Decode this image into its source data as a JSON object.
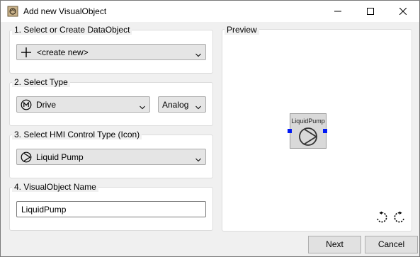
{
  "window": {
    "title": "Add new VisualObject",
    "icon": "app-cube-icon",
    "controls": [
      "minimize-icon",
      "maximize-icon",
      "close-icon"
    ]
  },
  "step1": {
    "label": "1. Select or Create DataObject",
    "value": "<create new>",
    "icon": "plus-icon"
  },
  "step2": {
    "label": "2. Select Type",
    "type_value": "Drive",
    "type_icon": "m-circle-icon",
    "signal_value": "Analog"
  },
  "step3": {
    "label": "3. Select HMI Control Type (Icon)",
    "value": "Liquid Pump",
    "icon": "pump-icon"
  },
  "step4": {
    "label": "4. VisualObject Name",
    "value": "LiquidPump"
  },
  "preview": {
    "label": "Preview",
    "object_label": "LiquidPump",
    "rotate_left_icon": "rotate-left-icon",
    "rotate_right_icon": "rotate-right-icon"
  },
  "buttons": {
    "next": "Next",
    "cancel": "Cancel"
  },
  "colors": {
    "selection_handle": "#0018f5",
    "control_fill": "#e5e5e5"
  }
}
